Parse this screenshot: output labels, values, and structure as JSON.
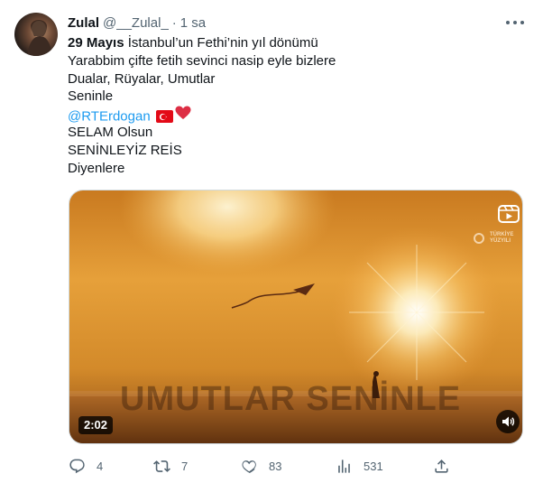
{
  "tweet": {
    "display_name": "Zulal",
    "handle": "@__Zulal_",
    "separator": "·",
    "time": "1 sa",
    "lines": {
      "l1_bold": "29 Mayıs",
      "l1_rest": " İstanbul’un Fethi’nin yıl dönümü",
      "l2": "Yarabbim çifte fetih sevinci nasip eyle bizlere",
      "l3": "Dualar, Rüyalar, Umutlar",
      "l4": "Seninle",
      "l5_mention": "@RTErdogan",
      "l6": "SELAM Olsun",
      "l7": "SENİNLEYİZ REİS",
      "l8": "Diyenlere"
    }
  },
  "media": {
    "overlay_text": "UMUTLAR SENİNLE",
    "brand_line1": "TÜRKİYE",
    "brand_line2": "YÜZYILI",
    "duration": "2:02"
  },
  "actions": {
    "replies": "4",
    "retweets": "7",
    "likes": "83",
    "views": "531"
  },
  "colors": {
    "text": "#0f1419",
    "secondary": "#536471",
    "link": "#1d9bf0",
    "border": "#cfd9de"
  }
}
